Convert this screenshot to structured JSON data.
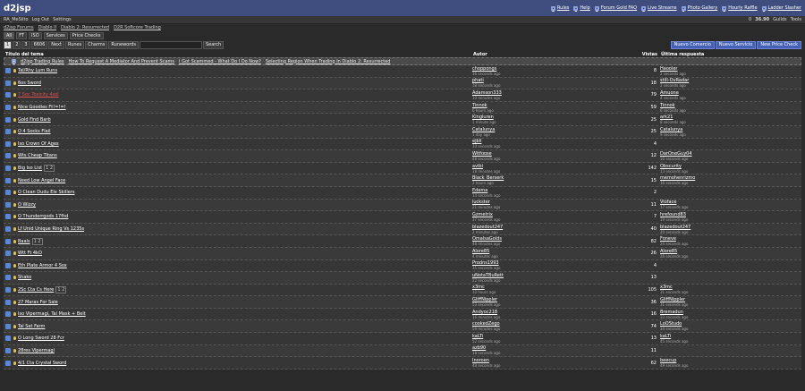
{
  "header": {
    "logo": "d2jsp",
    "links": [
      {
        "label": "Rules",
        "icon": "rules-icon"
      },
      {
        "label": "Help",
        "icon": "help-icon"
      },
      {
        "label": "Forum Gold FAQ",
        "icon": "gold-faq-icon"
      },
      {
        "label": "Live Streams",
        "icon": "stream-icon"
      },
      {
        "label": "Photo Gallery",
        "icon": "photo-icon"
      },
      {
        "label": "Hourly Raffle",
        "icon": "raffle-icon"
      },
      {
        "label": "Ladder Slasher",
        "icon": "slasher-icon"
      }
    ]
  },
  "userbar": {
    "username": "RA_MeSiito",
    "logout": "Log Out",
    "settings": "Settings",
    "notif_count": "0",
    "gold": "36.90",
    "guilds": "Guilds",
    "tools": "Tools"
  },
  "breadcrumbs": [
    "d2jsp Forums",
    "Diablo II",
    "Diablo 2: Resurrected",
    "D2R Softcore Trading"
  ],
  "filters": [
    "All",
    "FT",
    "ISO",
    "Services",
    "Price Checks"
  ],
  "pager": {
    "pages": [
      "1",
      "2",
      "3",
      "6606"
    ],
    "next": "Next",
    "tabs": [
      "Runes",
      "Charms",
      "Runewords"
    ],
    "search_btn": "Search",
    "search_placeholder": ""
  },
  "actions": [
    "Nuevo Comercio",
    "Nuevo Servicio",
    "New Price Check"
  ],
  "columns": {
    "title": "Título del tema",
    "author": "Autor",
    "views": "Vistas",
    "last": "Última respuesta"
  },
  "sticky": [
    "d2jsp Trading Rules",
    "How To Request A Mediator And Prevent Scams",
    "I Got Scammed - What Do I Do Now?",
    "Selecting Region When Trading In Diablo 2: Resurrected"
  ],
  "rows": [
    {
      "title": "Tal/Rhy Lum Runs",
      "author": "choppongs",
      "atime": "36 seconds ago",
      "views": "8",
      "last": "Haooler",
      "ltime": "2 seconds ago"
    },
    {
      "title": "6os Sword",
      "author": "phati",
      "atime": "18 seconds ago",
      "views": "18",
      "last": "still-OvRadar",
      "ltime": "2 seconds ago"
    },
    {
      "title": "7 Soc Toxicity 4sel",
      "author": "Adamson333",
      "atime": "10 minutes ago",
      "views": "79",
      "last": "Amuone",
      "ltime": "4 seconds ago",
      "red": true
    },
    {
      "title": "Nice Goodies Ft!=!=!",
      "author": "Tinnok",
      "atime": "6 hours ago",
      "views": "59",
      "last": "Tinnok",
      "ltime": "6 seconds ago"
    },
    {
      "title": "Gold Find Barb",
      "author": "Kingluren",
      "atime": "1 minute ago",
      "views": "25",
      "last": "ark21",
      "ltime": "8 seconds ago"
    },
    {
      "title": "O 4 Socks Flail",
      "author": "Catalunya",
      "atime": "1 day ago",
      "views": "25",
      "last": "Catalunya",
      "ltime": "9 seconds ago"
    },
    {
      "title": "Iso Crown Of Ages",
      "author": "eJbll",
      "atime": "10 seconds ago",
      "views": "4",
      "last": "",
      "ltime": ""
    },
    {
      "title": "Wts Cheap Titans",
      "author": "Witfoose",
      "atime": "48 seconds ago",
      "views": "12",
      "last": "DarOneGuy04",
      "ltime": "10 seconds ago"
    },
    {
      "title": "Big Iso List",
      "pages": "1 2",
      "author": "avibi",
      "atime": "18 minutes ago",
      "views": "142",
      "last": "Obscurity",
      "ltime": "13 seconds ago"
    },
    {
      "title": "Need Low Angel Face",
      "author": "Black_Berserk",
      "atime": "2 hours ago",
      "views": "15",
      "last": "memohenrizmo",
      "ltime": "16 seconds ago"
    },
    {
      "title": "O Clean Dudu Ele Skillers",
      "author": "Edema",
      "atime": "14 seconds ago",
      "views": "2",
      "last": "",
      "ltime": ""
    },
    {
      "title": "O Wizzy",
      "author": "luckster",
      "atime": "21 minutes ago",
      "views": "11",
      "last": "Vioface",
      "ltime": "17 seconds ago"
    },
    {
      "title": "O Thunderrgods 17fhd",
      "author": "Gzmetrix",
      "atime": "37 seconds ago",
      "views": "7",
      "last": "hrefound83",
      "ltime": "19 seconds ago"
    },
    {
      "title": "Lf Unid Unique Ring Vs 1235s",
      "author": "blazedout247",
      "atime": "2 minutes ago",
      "views": "40",
      "last": "blazedout247",
      "ltime": "20 seconds ago"
    },
    {
      "title": "Baals",
      "pages": "1 2",
      "author": "OmalsaGolds",
      "atime": "48 minutes ago",
      "views": "82",
      "last": "Foneve",
      "ltime": "24 seconds ago"
    },
    {
      "title": "Wtt Ft 4kO",
      "author": "Alore85",
      "atime": "4 minutes ago",
      "views": "26",
      "last": "Alore85",
      "ltime": "26 seconds ago"
    },
    {
      "title": "Eth Plate Armor 4 Sox",
      "author": "Prodns1993",
      "atime": "35 seconds ago",
      "views": "4",
      "last": "",
      "ltime": ""
    },
    {
      "title": "Shako",
      "author": "uNotaTBuRett",
      "atime": "22 seconds ago",
      "views": "13",
      "last": "",
      "ltime": ""
    },
    {
      "title": "2Sc Cta Cs Here",
      "pages": "1 2",
      "author": "x3mc",
      "atime": "10 hours ago",
      "views": "105",
      "last": "x3mc",
      "ltime": "31 seconds ago"
    },
    {
      "title": "27 Maras For Sale",
      "author": "GliffNippler",
      "atime": "53 seconds ago",
      "views": "36",
      "last": "GliffNippler",
      "ltime": "31 seconds ago"
    },
    {
      "title": "Iso Vipermagi, Tal Mask + Belt",
      "author": "Andyoc218",
      "atime": "16 minutes ago",
      "views": "16",
      "last": "Bremadun",
      "ltime": "33 seconds ago"
    },
    {
      "title": "Tal Set Farm",
      "author": "cookedZego",
      "atime": "59 minutes ago",
      "views": "74",
      "last": "LoOStudo",
      "ltime": "34 seconds ago"
    },
    {
      "title": "O Long Sword 28 Fcr",
      "author": "kaLTi",
      "atime": "52 seconds ago",
      "views": "13",
      "last": "kaLTi",
      "ltime": "45 seconds ago"
    },
    {
      "title": "28res Vipermagi",
      "author": "azb90",
      "atime": "18 seconds ago",
      "views": "11",
      "last": "",
      "ltime": ""
    },
    {
      "title": "4/1 Cta Crystal Sword",
      "author": "Inoroen",
      "atime": "48 seconds ago",
      "views": "62",
      "last": "beecup",
      "ltime": "49 seconds ago"
    }
  ]
}
